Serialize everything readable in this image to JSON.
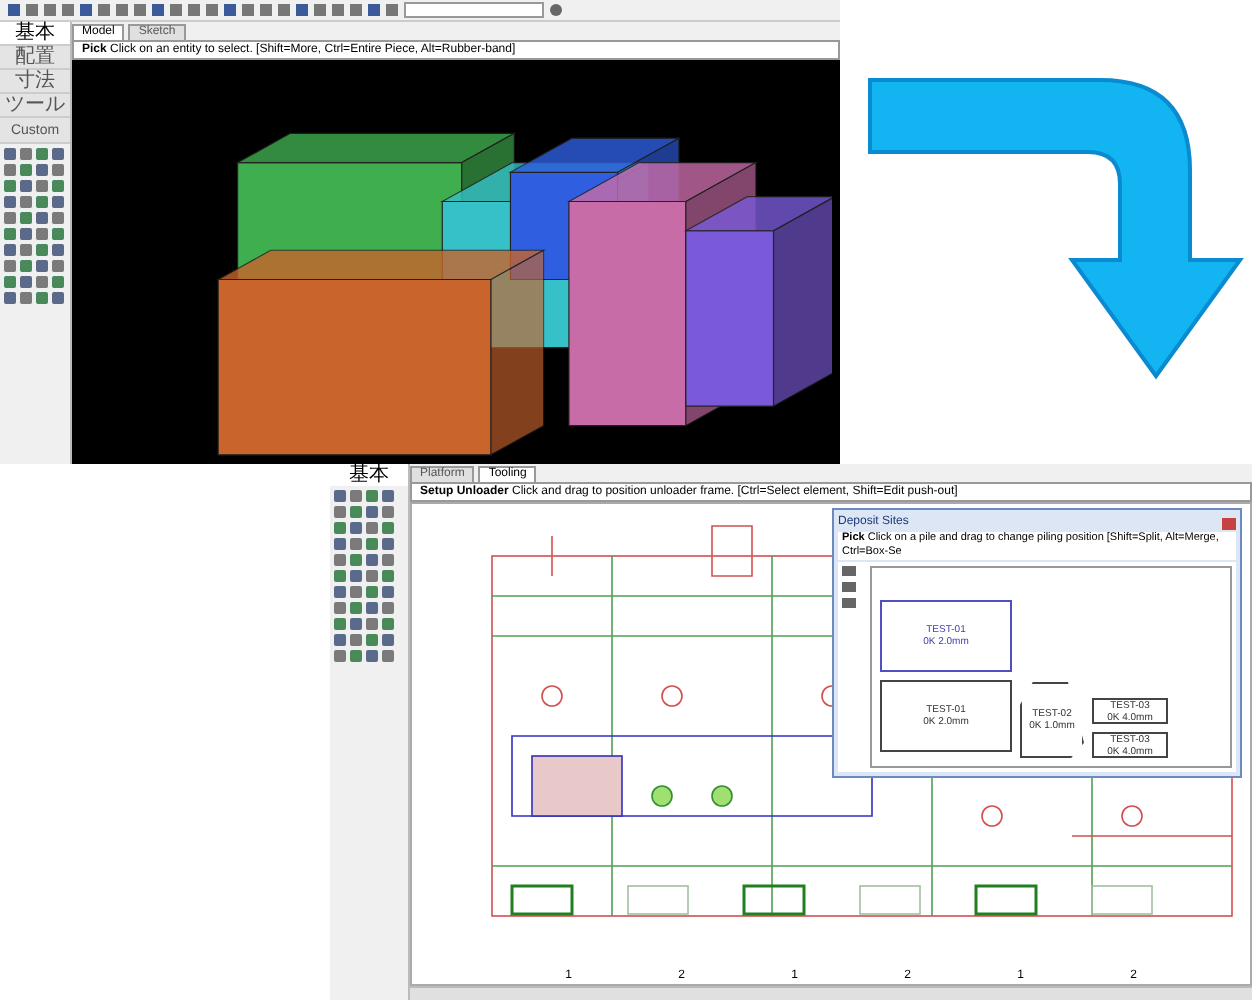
{
  "top_window": {
    "left_tabs": [
      {
        "label": "基本",
        "selected": true
      },
      {
        "label": "配置",
        "selected": false
      },
      {
        "label": "寸法",
        "selected": false
      },
      {
        "label": "ツール",
        "selected": false
      },
      {
        "label": "Custom",
        "selected": false
      }
    ],
    "view_tabs": [
      {
        "label": "Model",
        "selected": true
      },
      {
        "label": "Sketch",
        "selected": false
      }
    ],
    "prompt": {
      "command": "Pick",
      "text": "Click on an entity to select. [Shift=More, Ctrl=Entire Piece, Alt=Rubber-band]"
    }
  },
  "bottom_window": {
    "left_tabs": [
      {
        "label": "基本",
        "selected": true
      }
    ],
    "view_tabs": [
      {
        "label": "Platform",
        "selected": false
      },
      {
        "label": "Tooling",
        "selected": true
      }
    ],
    "prompt": {
      "command": "Setup Unloader",
      "text": "Click and drag to position unloader frame. [Ctrl=Select element, Shift=Edit push-out]"
    },
    "dialog": {
      "title": "Deposit Sites",
      "prompt": {
        "command": "Pick",
        "text": "Click on a pile and drag to change piling position [Shift=Split, Alt=Merge, Ctrl=Box-Se"
      },
      "parts": [
        {
          "kind": "large",
          "name": "TEST-01",
          "size": "0K 2.0mm",
          "selected": true
        },
        {
          "kind": "large",
          "name": "TEST-01",
          "size": "0K 2.0mm",
          "selected": false
        },
        {
          "kind": "odd",
          "name": "TEST-02",
          "size": "0K 1.0mm",
          "selected": false
        },
        {
          "kind": "small",
          "name": "TEST-03",
          "size": "0K 4.0mm",
          "selected": false
        },
        {
          "kind": "small",
          "name": "TEST-03",
          "size": "0K 4.0mm",
          "selected": false
        }
      ]
    },
    "bin_labels": [
      "1",
      "2",
      "1",
      "2",
      "1",
      "2"
    ]
  }
}
